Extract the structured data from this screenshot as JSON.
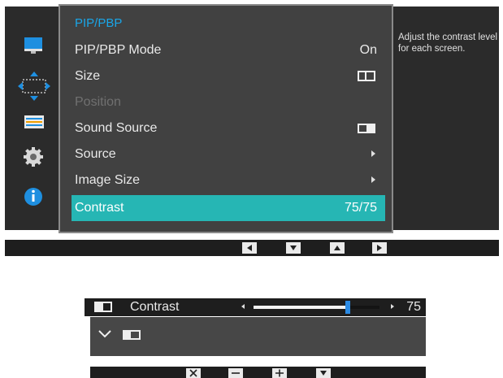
{
  "menu": {
    "title": "PIP/PBP",
    "items": [
      {
        "label": "PIP/PBP Mode",
        "value": "On"
      },
      {
        "label": "Size",
        "icon": "pbp-split-icon"
      },
      {
        "label": "Position"
      },
      {
        "label": "Sound Source",
        "icon": "half-screen-icon"
      },
      {
        "label": "Source",
        "icon": "submenu-arrow-icon"
      },
      {
        "label": "Image Size",
        "icon": "submenu-arrow-icon"
      },
      {
        "label": "Contrast",
        "value": "75/75"
      }
    ]
  },
  "sidebar": {
    "icons": [
      "picture-icon",
      "pip-pbp-icon",
      "color-settings-icon",
      "gear-icon",
      "info-icon"
    ],
    "active": "pip-pbp-icon"
  },
  "help": {
    "text": "Adjust the contrast level for each screen."
  },
  "nav": {
    "buttons": [
      "left-arrow-icon",
      "down-arrow-icon",
      "up-arrow-icon",
      "right-arrow-icon"
    ]
  },
  "contrast": {
    "label": "Contrast",
    "value": "75",
    "level": 0.75
  },
  "bottom_nav": {
    "buttons": [
      "close-icon",
      "minus-icon",
      "plus-icon",
      "down-arrow-icon"
    ]
  },
  "colors": {
    "accent": "#26b6b4",
    "title": "#1aa6e8",
    "knob": "#2a8ae4"
  }
}
